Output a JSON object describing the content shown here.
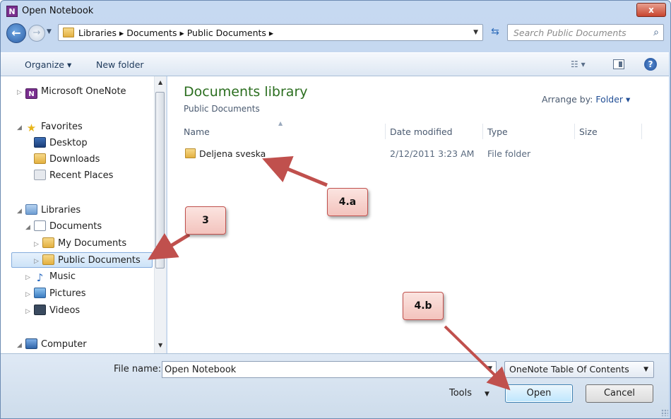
{
  "window": {
    "title": "Open Notebook",
    "app_icon": "onenote-icon",
    "close_label": "x"
  },
  "nav": {
    "back": "back-arrow-icon",
    "forward": "forward-arrow-icon",
    "breadcrumb": "Libraries ▸ Documents ▸ Public Documents ▸",
    "search_placeholder": "Search Public Documents"
  },
  "commands": {
    "organize": "Organize ▾",
    "new_folder": "New folder"
  },
  "sidebar": {
    "items": [
      {
        "label": "Microsoft OneNote",
        "icon": "onenote-icon",
        "exp": "▷"
      },
      {
        "label": "Favorites",
        "icon": "star-icon",
        "exp": "◢"
      },
      {
        "label": "Desktop",
        "icon": "desktop-icon",
        "exp": ""
      },
      {
        "label": "Downloads",
        "icon": "downloads-icon",
        "exp": ""
      },
      {
        "label": "Recent Places",
        "icon": "recent-places-icon",
        "exp": ""
      },
      {
        "label": "Libraries",
        "icon": "library-icon",
        "exp": "◢"
      },
      {
        "label": "Documents",
        "icon": "documents-icon",
        "exp": "◢"
      },
      {
        "label": "My Documents",
        "icon": "folder-icon",
        "exp": "▷"
      },
      {
        "label": "Public Documents",
        "icon": "folder-icon",
        "exp": "▷"
      },
      {
        "label": "Music",
        "icon": "music-icon",
        "exp": "▷"
      },
      {
        "label": "Pictures",
        "icon": "pictures-icon",
        "exp": "▷"
      },
      {
        "label": "Videos",
        "icon": "videos-icon",
        "exp": "▷"
      },
      {
        "label": "Computer",
        "icon": "computer-icon",
        "exp": "◢"
      }
    ],
    "selected": "Public Documents"
  },
  "main": {
    "title": "Documents library",
    "subtitle": "Public Documents",
    "arrange_label": "Arrange by:",
    "arrange_value": "Folder ▾",
    "columns": [
      "Name",
      "Date modified",
      "Type",
      "Size"
    ],
    "rows": [
      {
        "name": "Deljena sveska",
        "date": "2/12/2011 3:23 AM",
        "type": "File folder",
        "size": ""
      }
    ]
  },
  "footer": {
    "file_name_label": "File name:",
    "file_name_value": "Open Notebook",
    "file_type": "OneNote Table Of Contents",
    "tools_label": "Tools",
    "open_label": "Open",
    "cancel_label": "Cancel"
  },
  "callouts": {
    "c3": "3",
    "c4a": "4.a",
    "c4b": "4.b"
  },
  "colors": {
    "accent_title": "#2b6e1f",
    "callout_fill": "#f3c3bd",
    "arrow": "#c0504d"
  }
}
